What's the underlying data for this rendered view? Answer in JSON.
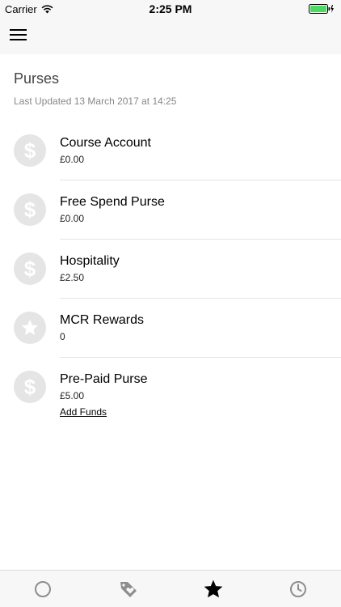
{
  "status_bar": {
    "carrier": "Carrier",
    "time": "2:25 PM",
    "battery_color": "#4cd964"
  },
  "header": {
    "menu_icon": "hamburger-menu-icon"
  },
  "page": {
    "title": "Purses",
    "last_updated": "Last Updated 13 March 2017 at 14:25"
  },
  "purses": [
    {
      "name": "Course Account",
      "amount": "£0.00",
      "icon": "dollar-icon"
    },
    {
      "name": "Free Spend Purse",
      "amount": "£0.00",
      "icon": "dollar-icon"
    },
    {
      "name": "Hospitality",
      "amount": "£2.50",
      "icon": "dollar-icon"
    },
    {
      "name": "MCR Rewards",
      "amount": "0",
      "icon": "star-icon"
    },
    {
      "name": "Pre-Paid Purse",
      "amount": "£5.00",
      "icon": "dollar-icon",
      "action": "Add Funds"
    }
  ],
  "tab_bar": {
    "tabs": [
      {
        "icon": "circle-icon",
        "active": false
      },
      {
        "icon": "tag-heart-icon",
        "active": false
      },
      {
        "icon": "star-icon",
        "active": true
      },
      {
        "icon": "clock-icon",
        "active": false
      }
    ],
    "active_color": "#000000",
    "inactive_color": "#8e8e8e"
  }
}
